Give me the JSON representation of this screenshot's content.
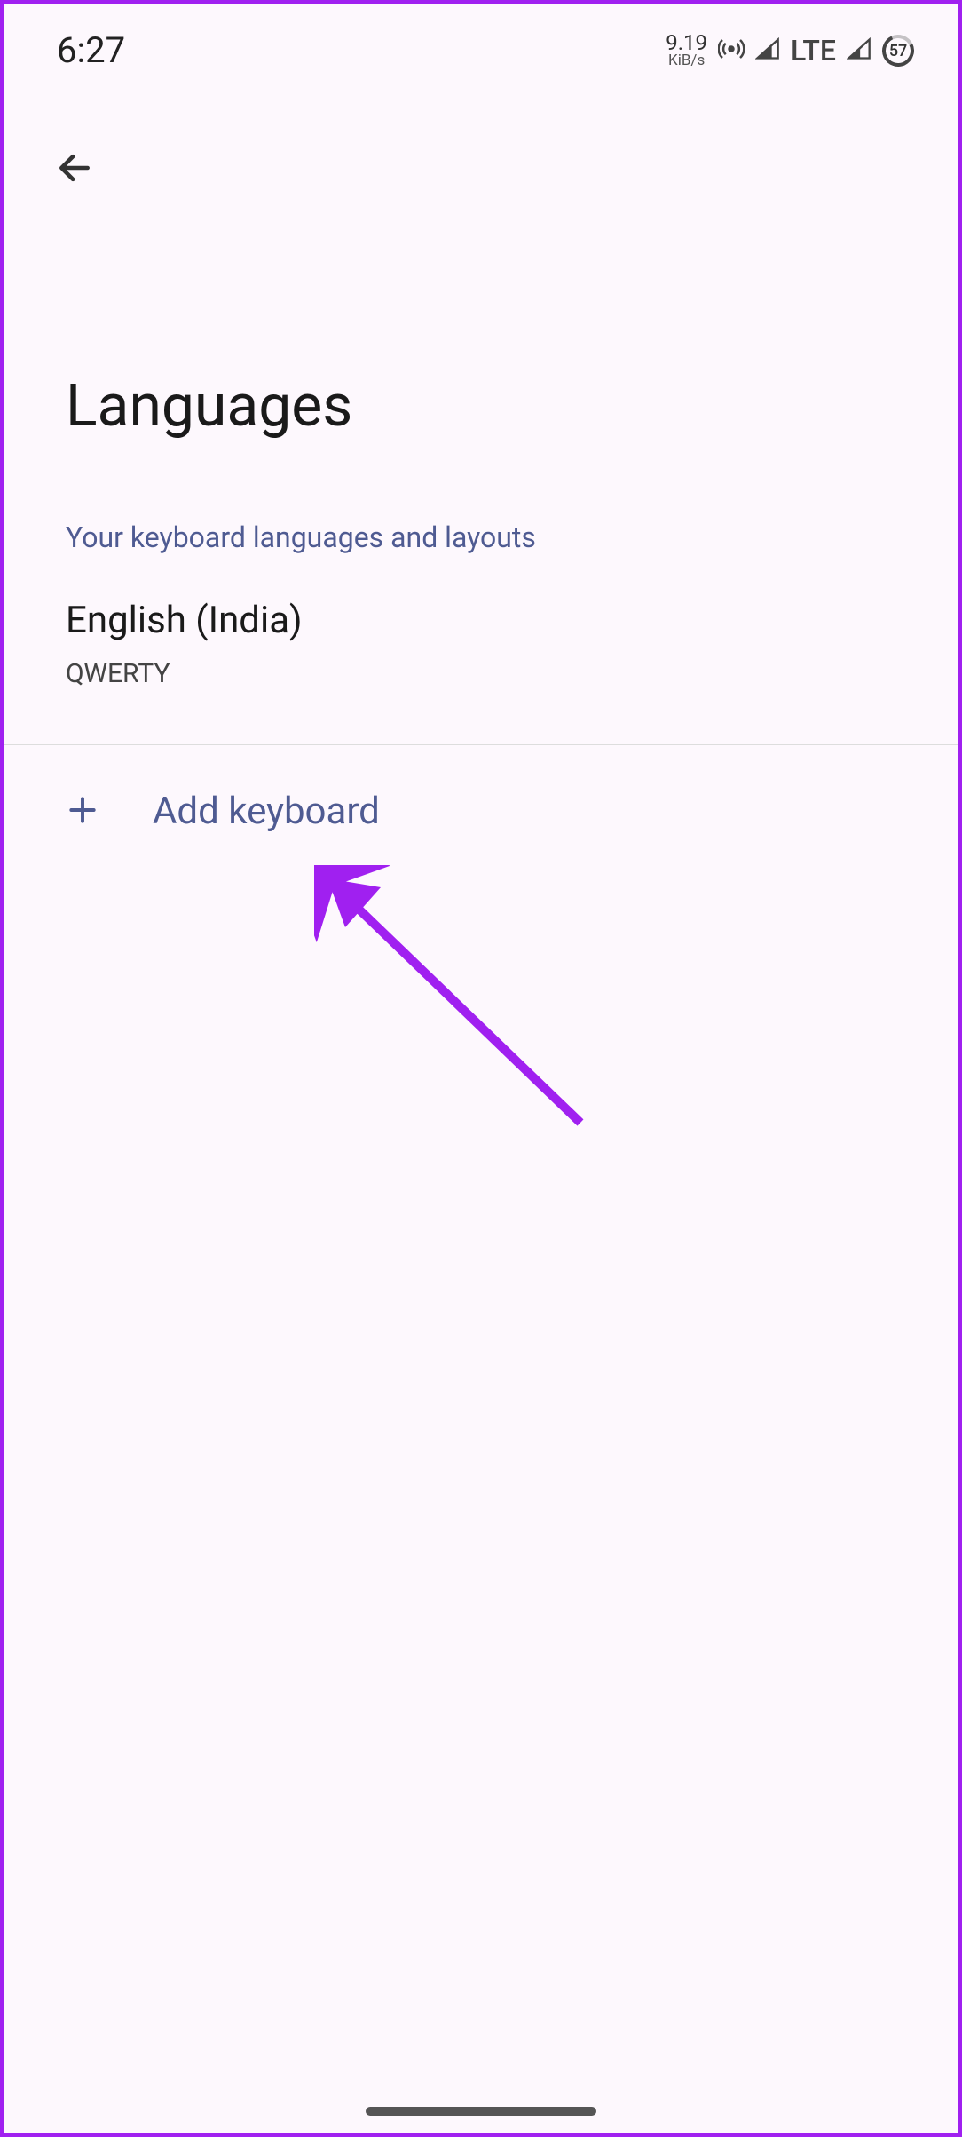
{
  "status": {
    "time": "6:27",
    "dataRate": "9.19",
    "dataUnit": "KiB/s",
    "network": "LTE",
    "battery": "57"
  },
  "page": {
    "title": "Languages",
    "subtitle": "Your keyboard languages and layouts"
  },
  "languages": [
    {
      "name": "English (India)",
      "layout": "QWERTY"
    }
  ],
  "actions": {
    "addKeyboard": "Add keyboard"
  }
}
